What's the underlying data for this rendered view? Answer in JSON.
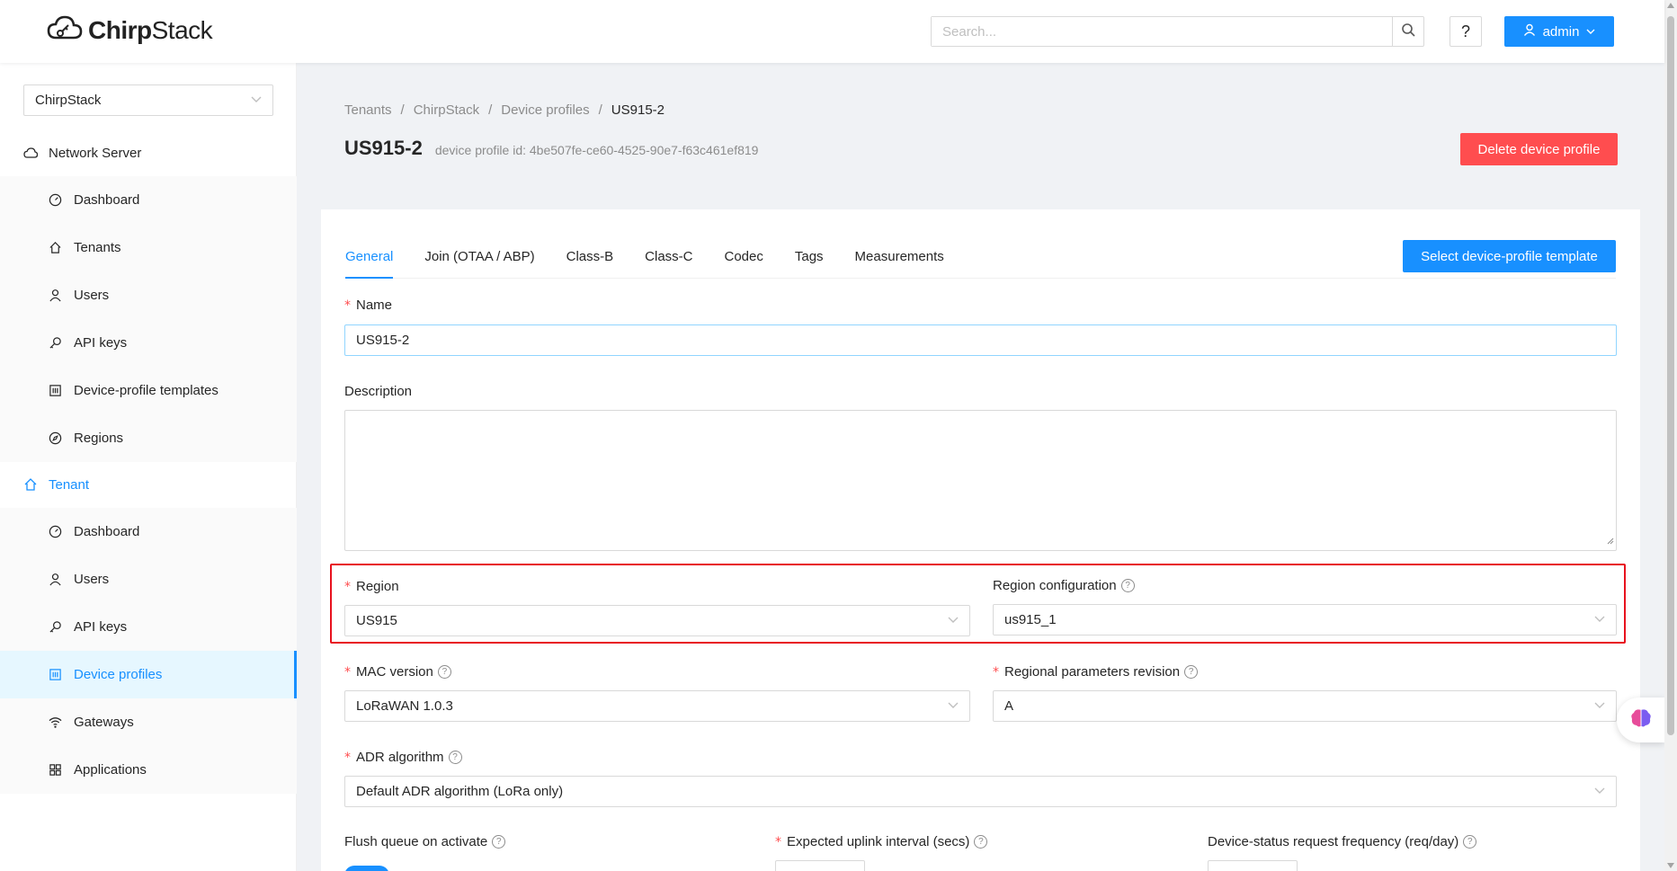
{
  "header": {
    "logo_text_bold": "Chirp",
    "logo_text_thin": "Stack",
    "search_placeholder": "Search...",
    "help_label": "?",
    "user_label": "admin"
  },
  "sidebar": {
    "tenant_select": "ChirpStack",
    "network_server_label": "Network Server",
    "ns_items": [
      {
        "label": "Dashboard",
        "icon": "dashboard-icon"
      },
      {
        "label": "Tenants",
        "icon": "home-icon"
      },
      {
        "label": "Users",
        "icon": "user-icon"
      },
      {
        "label": "API keys",
        "icon": "key-icon"
      },
      {
        "label": "Device-profile templates",
        "icon": "template-icon"
      },
      {
        "label": "Regions",
        "icon": "compass-icon"
      }
    ],
    "tenant_label": "Tenant",
    "tenant_items": [
      {
        "label": "Dashboard",
        "icon": "dashboard-icon"
      },
      {
        "label": "Users",
        "icon": "user-icon"
      },
      {
        "label": "API keys",
        "icon": "key-icon"
      },
      {
        "label": "Device profiles",
        "icon": "template-icon"
      },
      {
        "label": "Gateways",
        "icon": "wifi-icon"
      },
      {
        "label": "Applications",
        "icon": "apps-icon"
      }
    ]
  },
  "breadcrumb": [
    "Tenants",
    "ChirpStack",
    "Device profiles",
    "US915-2"
  ],
  "page": {
    "title": "US915-2",
    "subtitle": "device profile id: 4be507fe-ce60-4525-90e7-f63c461ef819",
    "delete_label": "Delete device profile"
  },
  "tabs": [
    "General",
    "Join (OTAA / ABP)",
    "Class-B",
    "Class-C",
    "Codec",
    "Tags",
    "Measurements"
  ],
  "template_button": "Select device-profile template",
  "form": {
    "name_label": "Name",
    "name_value": "US915-2",
    "description_label": "Description",
    "region_label": "Region",
    "region_value": "US915",
    "region_config_label": "Region configuration",
    "region_config_value": "us915_1",
    "mac_label": "MAC version",
    "mac_value": "LoRaWAN 1.0.3",
    "rp_label": "Regional parameters revision",
    "rp_value": "A",
    "adr_label": "ADR algorithm",
    "adr_value": "Default ADR algorithm (LoRa only)",
    "flush_label": "Flush queue on activate",
    "uplink_label": "Expected uplink interval (secs)",
    "status_label": "Device-status request frequency (req/day)"
  },
  "colors": {
    "primary": "#1890ff",
    "danger": "#ff4d4f",
    "highlight": "#e8121e"
  }
}
